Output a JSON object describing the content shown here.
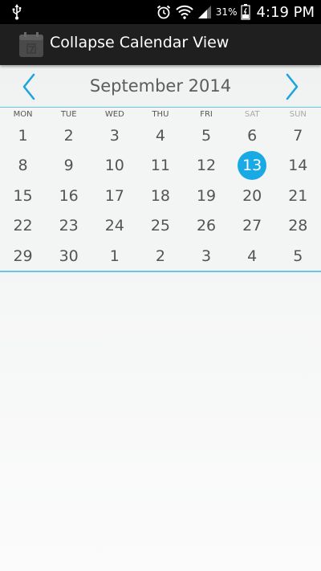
{
  "status_bar": {
    "battery_percent": "31%",
    "time": "4:19 PM"
  },
  "action_bar": {
    "title": "Collapse Calendar View"
  },
  "calendar": {
    "month_title": "September 2014",
    "weekdays": [
      "MON",
      "TUE",
      "WED",
      "THU",
      "FRI",
      "SAT",
      "SUN"
    ],
    "selected_day": "13",
    "accent_color": "#19a9e4",
    "weeks": [
      [
        "1",
        "2",
        "3",
        "4",
        "5",
        "6",
        "7"
      ],
      [
        "8",
        "9",
        "10",
        "11",
        "12",
        "13",
        "14"
      ],
      [
        "15",
        "16",
        "17",
        "18",
        "19",
        "20",
        "21"
      ],
      [
        "22",
        "23",
        "24",
        "25",
        "26",
        "27",
        "28"
      ],
      [
        "29",
        "30",
        "1",
        "2",
        "3",
        "4",
        "5"
      ]
    ]
  }
}
